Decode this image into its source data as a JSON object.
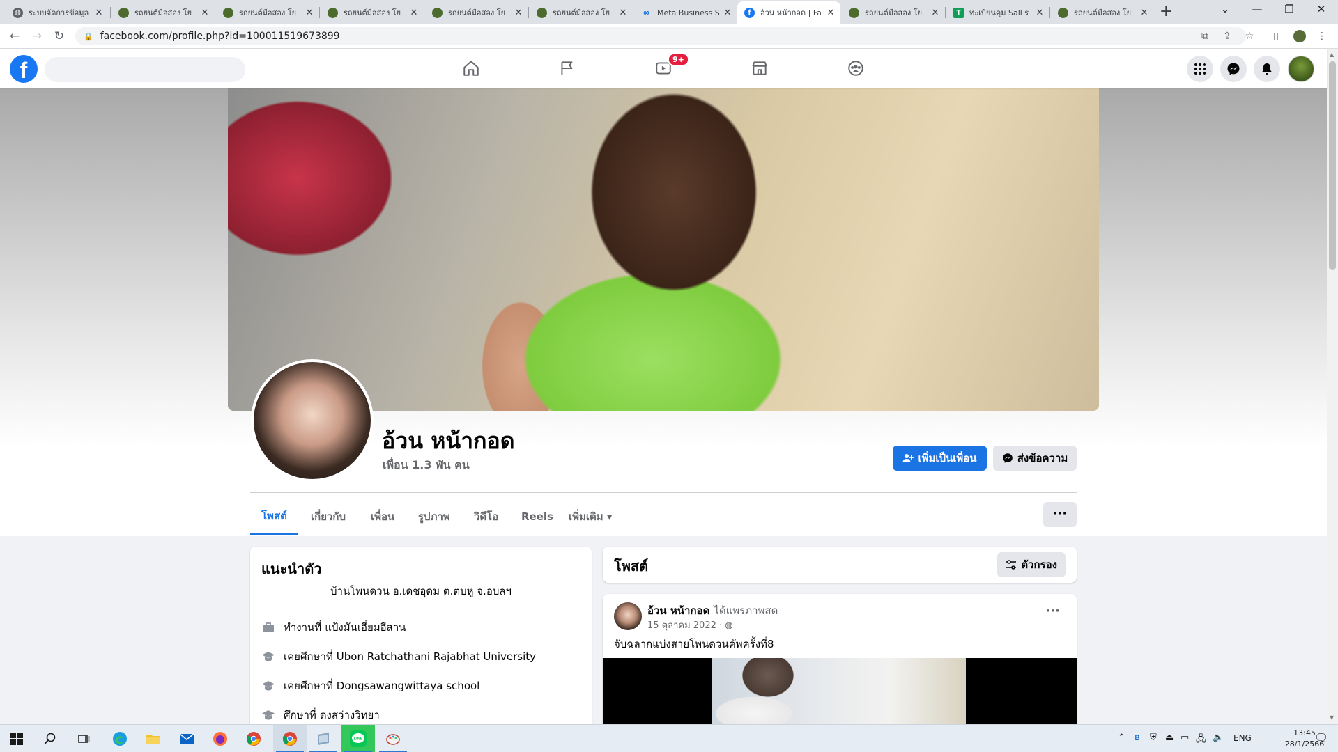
{
  "browser": {
    "tabs": [
      {
        "title": "ระบบจัดการข้อมูล",
        "active": false,
        "favicon": "globe-icon"
      },
      {
        "title": "รถยนต์มือสอง โย",
        "active": false,
        "favicon": "car-site-icon"
      },
      {
        "title": "รถยนต์มือสอง โย",
        "active": false,
        "favicon": "car-site-icon"
      },
      {
        "title": "รถยนต์มือสอง โย",
        "active": false,
        "favicon": "car-site-icon"
      },
      {
        "title": "รถยนต์มือสอง โย",
        "active": false,
        "favicon": "car-site-icon"
      },
      {
        "title": "รถยนต์มือสอง โย",
        "active": false,
        "favicon": "car-site-icon"
      },
      {
        "title": "Meta Business S",
        "active": false,
        "favicon": "meta-icon"
      },
      {
        "title": "อ้วน หน้ากอด | Fa",
        "active": true,
        "favicon": "facebook-icon"
      },
      {
        "title": "รถยนต์มือสอง โย",
        "active": false,
        "favicon": "car-site-icon"
      },
      {
        "title": "ทะเบียนคุม Sall ร",
        "active": false,
        "favicon": "sheets-icon"
      },
      {
        "title": "รถยนต์มือสอง โย",
        "active": false,
        "favicon": "car-site-icon"
      }
    ],
    "url": "facebook.com/profile.php?id=100011519673899"
  },
  "fb_nav": {
    "video_badge": "9+",
    "brand_color": "#1877f2"
  },
  "profile": {
    "name": "อ้วน หน้ากอด",
    "friends": "เพื่อน 1.3 พัน คน",
    "add_friend_label": "เพิ่มเป็นเพื่อน",
    "message_label": "ส่งข้อความ",
    "more_label": "···",
    "tabs": [
      {
        "label": "โพสต์"
      },
      {
        "label": "เกี่ยวกับ"
      },
      {
        "label": "เพื่อน"
      },
      {
        "label": "รูปภาพ"
      },
      {
        "label": "วิดีโอ"
      },
      {
        "label": "Reels"
      },
      {
        "label": "เพิ่มเติม ▾"
      }
    ]
  },
  "intro": {
    "title": "แนะนำตัว",
    "bio": "บ้านโพนดวน อ.เดชอุดม ต.ตบหู จ.อบลฯ",
    "items": [
      {
        "icon": "briefcase-icon",
        "prefix": "ทำงานที่",
        "value": "แป้งมันเอี่ยมอีสาน"
      },
      {
        "icon": "graduation-cap-icon",
        "prefix": "เคยศึกษาที่",
        "value": "Ubon Ratchathani Rajabhat University"
      },
      {
        "icon": "graduation-cap-icon",
        "prefix": "เคยศึกษาที่",
        "value": "Dongsawangwittaya school"
      },
      {
        "icon": "graduation-cap-icon",
        "prefix": "ศึกษาที่",
        "value": "ดงสว่างวิทยา"
      }
    ]
  },
  "posts": {
    "title": "โพสต์",
    "filter_label": "ตัวกรอง",
    "items": [
      {
        "author": "อ้วน หน้ากอด",
        "action": "ได้แพร่ภาพสด",
        "date": "15 ตุลาคม 2022 · ",
        "text": "จับฉลากแบ่งสายโพนดวนคัพครั้งที่8"
      }
    ]
  },
  "taskbar": {
    "lang": "ENG",
    "time": "13:45",
    "date": "28/1/2566"
  }
}
